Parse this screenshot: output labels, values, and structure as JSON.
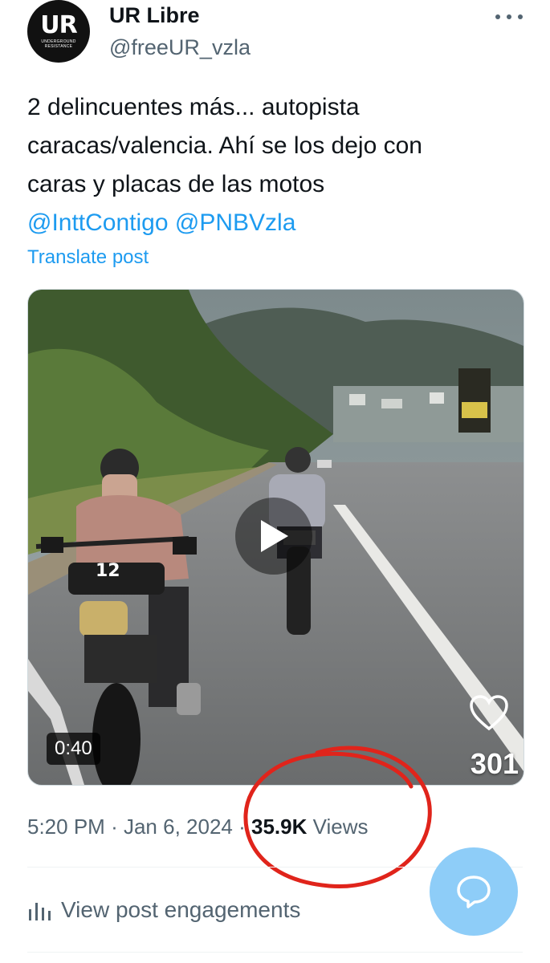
{
  "author": {
    "display_name": "UR Libre",
    "handle": "@freeUR_vzla",
    "avatar_monogram": "UR",
    "avatar_subtext": "UNDERGROUND RESISTANCE"
  },
  "post": {
    "text_lines": [
      "2 delincuentes más... autopista",
      "caracas/valencia. Ahí se los dejo con",
      "caras y placas de las motos"
    ],
    "mentions": [
      "@InttContigo",
      "@PNBVzla"
    ],
    "translate_label": "Translate post"
  },
  "media": {
    "duration": "0:40",
    "like_count": "301",
    "plate_text": "12",
    "icons": {
      "play": "play-icon",
      "heart": "heart-icon"
    }
  },
  "meta": {
    "time": "5:20 PM",
    "date": "Jan 6, 2024",
    "views_count": "35.9K",
    "views_label": "Views"
  },
  "engagements_label": "View post engagements",
  "colors": {
    "accent": "#1d9bf0",
    "muted": "#536471",
    "fab": "#8ecdf8",
    "annotation": "#e0241b"
  }
}
